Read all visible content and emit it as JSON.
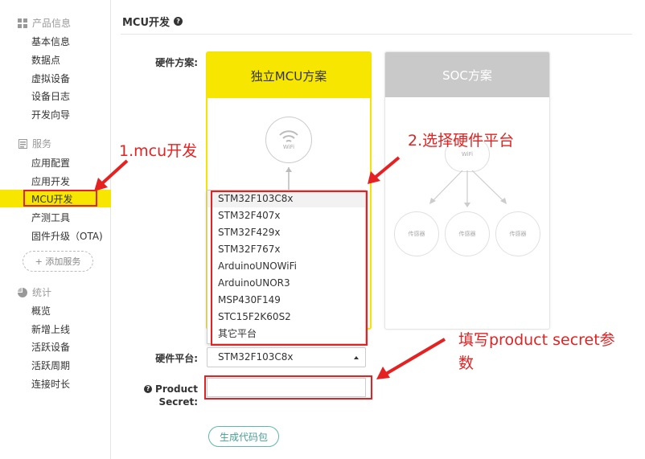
{
  "sidebar": {
    "sections": [
      {
        "title": "产品信息",
        "icon": "grid-icon",
        "items": [
          "基本信息",
          "数据点",
          "虚拟设备",
          "设备日志",
          "开发向导"
        ]
      },
      {
        "title": "服务",
        "icon": "document-icon",
        "items": [
          "应用配置",
          "应用开发",
          "MCU开发",
          "产测工具",
          "固件升级（OTA)"
        ]
      },
      {
        "title": "统计",
        "icon": "pie-chart-icon",
        "items": [
          "概览",
          "新增上线",
          "活跃设备",
          "活跃周期",
          "连接时长"
        ]
      }
    ],
    "active_item": "MCU开发",
    "add_service_label": "+ 添加服务"
  },
  "main": {
    "title": "MCU开发",
    "hardware_scheme_label": "硬件方案:",
    "cards": [
      {
        "title": "独立MCU方案",
        "selected": true
      },
      {
        "title": "SOC方案",
        "selected": false
      }
    ],
    "wifi_label": "WiFi",
    "sensor_label": "传感器",
    "hardware_platform_label": "硬件平台:",
    "platform_options": [
      "STM32F103C8x",
      "STM32F407x",
      "STM32F429x",
      "STM32F767x",
      "ArduinoUNOWiFi",
      "ArduinoUNOR3",
      "MSP430F149",
      "STC15F2K60S2",
      "其它平台"
    ],
    "platform_selected": "STM32F103C8x",
    "product_secret_label_1": "Product",
    "product_secret_label_2": "Secret:",
    "product_secret_value": "",
    "generate_button": "生成代码包"
  },
  "annotations": {
    "step1": "1.mcu开发",
    "step2": "2.选择硬件平台",
    "step3_line1": "填写product secret参",
    "step3_line2": "数"
  },
  "colors": {
    "accent_yellow": "#f7e600",
    "annotation_red": "#e52121",
    "button_teal": "#5fb8ad"
  }
}
